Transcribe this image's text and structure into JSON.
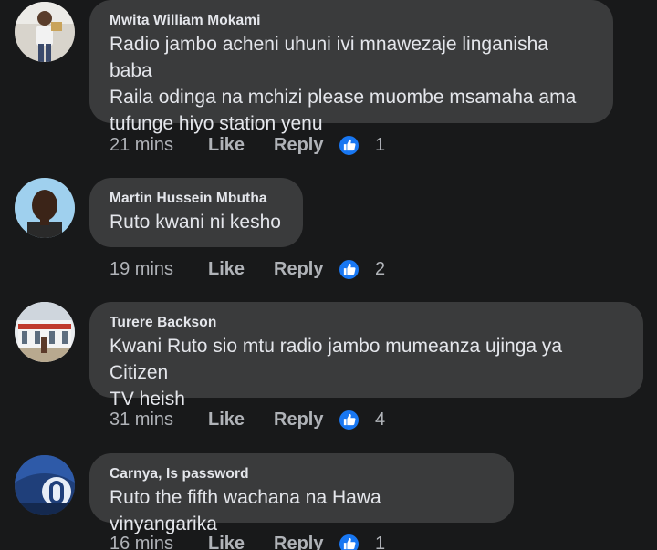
{
  "comments": [
    {
      "author": "Mwita William Mokami",
      "text": "Radio jambo acheni uhuni ivi mnawezaje linganisha baba\nRaila odinga na mchizi please muombe msamaha ama\ntufunge hiyo station yenu",
      "time": "21 mins",
      "like_label": "Like",
      "reply_label": "Reply",
      "reaction_icon": "thumbs-up-icon",
      "reaction_count": "1"
    },
    {
      "author": "Martin Hussein Mbutha",
      "text": "Ruto kwani ni kesho",
      "time": "19 mins",
      "like_label": "Like",
      "reply_label": "Reply",
      "reaction_icon": "thumbs-up-icon",
      "reaction_count": "2"
    },
    {
      "author": "Turere Backson",
      "text": "Kwani Ruto sio mtu radio jambo mumeanza ujinga ya Citizen\nTV heish",
      "time": "31 mins",
      "like_label": "Like",
      "reply_label": "Reply",
      "reaction_icon": "thumbs-up-icon",
      "reaction_count": "4"
    },
    {
      "author": "Carnya, Is password",
      "text": "Ruto the fifth wachana na Hawa vinyangarika",
      "time": "16 mins",
      "like_label": "Like",
      "reply_label": "Reply",
      "reaction_icon": "thumbs-up-icon",
      "reaction_count": "1"
    }
  ],
  "colors": {
    "background": "#18191a",
    "bubble": "#3a3b3c",
    "text": "#e4e6eb",
    "secondary_text": "#b0b3b8",
    "reaction_blue": "#1877f2"
  }
}
